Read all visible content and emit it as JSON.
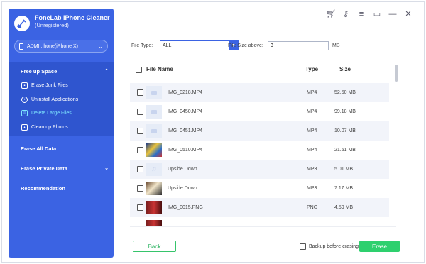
{
  "app": {
    "title": "FoneLab iPhone Cleaner",
    "subtitle": "(Unregistered)",
    "device": "ADMI...hone(iPhone X)"
  },
  "sidebar": {
    "free_up_space": "Free up Space",
    "items": [
      {
        "label": "Erase Junk Files",
        "icon": "trash-icon"
      },
      {
        "label": "Uninstall Applications",
        "icon": "apps-icon"
      },
      {
        "label": "Delete Large Files",
        "icon": "file-icon"
      },
      {
        "label": "Clean up Photos",
        "icon": "photo-icon"
      }
    ],
    "erase_all": "Erase All Data",
    "erase_private": "Erase Private Data",
    "recommendation": "Recommendation"
  },
  "filters": {
    "type_label": "File Type:",
    "type_value": "ALL",
    "size_label": "File Size above:",
    "size_value": "3",
    "size_unit": "MB"
  },
  "table": {
    "columns": [
      "File Name",
      "Type",
      "Size"
    ],
    "rows": [
      {
        "name": "IMG_0218.MP4",
        "type": "MP4",
        "size": "52.50 MB",
        "thumb": "video"
      },
      {
        "name": "IMG_0450.MP4",
        "type": "MP4",
        "size": "99.18 MB",
        "thumb": "video"
      },
      {
        "name": "IMG_0451.MP4",
        "type": "MP4",
        "size": "10.07 MB",
        "thumb": "video"
      },
      {
        "name": "IMG_0510.MP4",
        "type": "MP4",
        "size": "21.51 MB",
        "thumb": "img1"
      },
      {
        "name": "Upside Down",
        "type": "MP3",
        "size": "5.01 MB",
        "thumb": "audio"
      },
      {
        "name": "Upside Down",
        "type": "MP3",
        "size": "7.17 MB",
        "thumb": "img2"
      },
      {
        "name": "IMG_0015.PNG",
        "type": "PNG",
        "size": "4.59 MB",
        "thumb": "img3"
      }
    ]
  },
  "footer": {
    "back": "Back",
    "backup": "Backup before erasing",
    "erase": "Erase"
  },
  "colors": {
    "sidebar": "#3b63e3",
    "accent_green": "#2ed06e",
    "active_item": "#7fe6ff"
  }
}
